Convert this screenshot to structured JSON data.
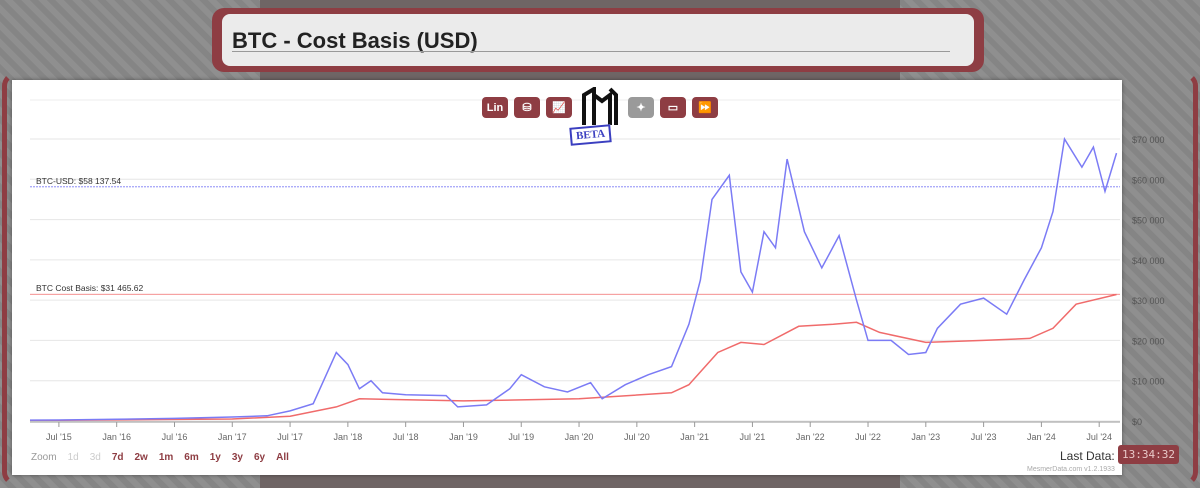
{
  "header": {
    "title": "BTC - Cost Basis (USD)"
  },
  "toolbar": {
    "lin_label": "Lin",
    "icons": [
      "database-icon",
      "chart-icon",
      "logo",
      "magic-wand-icon",
      "monitor-icon",
      "fast-forward-icon"
    ],
    "beta": "BETA"
  },
  "zoom": {
    "label": "Zoom",
    "options": [
      "1d",
      "3d",
      "7d",
      "2w",
      "1m",
      "6m",
      "1y",
      "3y",
      "6y",
      "All"
    ]
  },
  "footer": {
    "last_data_label": "Last Data:",
    "last_data_time": "13:34:32",
    "credit": "MesmerData.com v1.2.1933"
  },
  "colors": {
    "accent": "#8e3d43",
    "price": "#7b7bf5",
    "cost_basis": "#f06b6b"
  },
  "chart_data": {
    "type": "line",
    "title": "BTC - Cost Basis (USD)",
    "ylim": [
      0,
      70000
    ],
    "yticks": [
      0,
      10000,
      20000,
      30000,
      40000,
      50000,
      60000,
      70000
    ],
    "ytick_labels": [
      "$0",
      "$10 000",
      "$20 000",
      "$30 000",
      "$40 000",
      "$50 000",
      "$60 000",
      "$70 000"
    ],
    "xticks": [
      2015.5,
      2016,
      2016.5,
      2017,
      2017.5,
      2018,
      2018.5,
      2019,
      2019.5,
      2020,
      2020.5,
      2021,
      2021.5,
      2022,
      2022.5,
      2023,
      2023.5,
      2024,
      2024.5
    ],
    "xtick_labels": [
      "Jul '15",
      "Jan '16",
      "Jul '16",
      "Jan '17",
      "Jul '17",
      "Jan '18",
      "Jul '18",
      "Jan '19",
      "Jul '19",
      "Jan '20",
      "Jul '20",
      "Jan '21",
      "Jul '21",
      "Jan '22",
      "Jul '22",
      "Jan '23",
      "Jul '23",
      "Jan '24",
      "Jul '24"
    ],
    "xlim": [
      2015.25,
      2024.68
    ],
    "plot_lines": [
      {
        "label": "BTC-USD: $58 137.54",
        "value": 58137.54,
        "color": "#7b7bf5"
      },
      {
        "label": "BTC Cost Basis: $31 465.62",
        "value": 31465.62,
        "color": "#f06b6b"
      }
    ],
    "series": [
      {
        "name": "BTC-USD",
        "color": "#7b7bf5",
        "x": [
          2015.25,
          2015.5,
          2016,
          2016.5,
          2017,
          2017.3,
          2017.5,
          2017.7,
          2017.9,
          2018.0,
          2018.1,
          2018.2,
          2018.3,
          2018.5,
          2018.85,
          2018.95,
          2019.2,
          2019.4,
          2019.5,
          2019.7,
          2019.9,
          2020.1,
          2020.2,
          2020.4,
          2020.6,
          2020.8,
          2020.95,
          2021.05,
          2021.15,
          2021.3,
          2021.4,
          2021.5,
          2021.6,
          2021.7,
          2021.8,
          2021.95,
          2022.1,
          2022.25,
          2022.4,
          2022.5,
          2022.7,
          2022.85,
          2023.0,
          2023.1,
          2023.3,
          2023.5,
          2023.7,
          2023.85,
          2024.0,
          2024.1,
          2024.2,
          2024.35,
          2024.45,
          2024.55,
          2024.65
        ],
        "values": [
          230,
          250,
          430,
          650,
          1000,
          1300,
          2500,
          4300,
          17000,
          14000,
          8000,
          10000,
          7000,
          6500,
          6300,
          3500,
          4000,
          8000,
          11500,
          8500,
          7200,
          9500,
          5500,
          9000,
          11500,
          13500,
          24000,
          35000,
          55000,
          61000,
          37000,
          32000,
          47000,
          43000,
          65000,
          47000,
          38000,
          46000,
          30000,
          20000,
          20000,
          16500,
          17000,
          23000,
          29000,
          30500,
          26500,
          35000,
          43000,
          52000,
          70000,
          63000,
          68000,
          57000,
          66500
        ]
      },
      {
        "name": "BTC Cost Basis",
        "color": "#f06b6b",
        "x": [
          2015.25,
          2015.5,
          2017,
          2017.5,
          2017.9,
          2018.1,
          2019,
          2020,
          2020.8,
          2020.95,
          2021.2,
          2021.4,
          2021.6,
          2021.9,
          2022.2,
          2022.4,
          2022.6,
          2023,
          2023.5,
          2023.9,
          2024.1,
          2024.3,
          2024.65
        ],
        "values": [
          200,
          200,
          500,
          1200,
          3500,
          5500,
          5000,
          5500,
          7000,
          9000,
          17000,
          19500,
          19000,
          23500,
          24000,
          24500,
          22000,
          19500,
          20000,
          20500,
          23000,
          29000,
          31400
        ]
      }
    ]
  }
}
